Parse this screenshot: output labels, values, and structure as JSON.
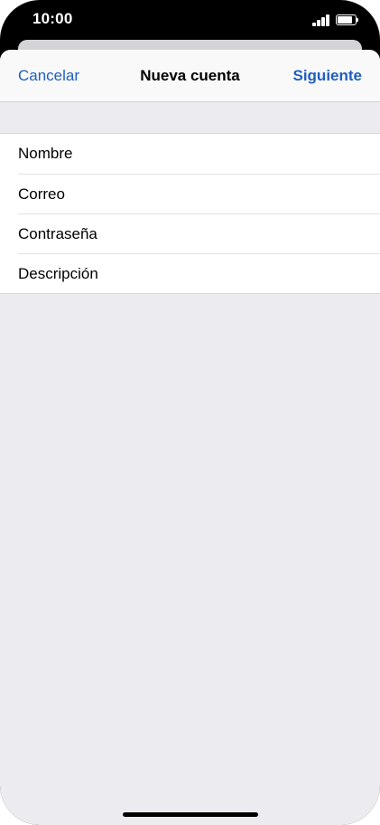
{
  "status_bar": {
    "time": "10:00",
    "signal_icon": "cellular-signal-icon",
    "battery_icon": "battery-icon",
    "battery_level": 0.9
  },
  "nav": {
    "cancel_label": "Cancelar",
    "title": "Nueva cuenta",
    "next_label": "Siguiente"
  },
  "form": {
    "fields": [
      {
        "placeholder": "Nombre",
        "value": ""
      },
      {
        "placeholder": "Correo",
        "value": ""
      },
      {
        "placeholder": "Contraseña",
        "value": ""
      },
      {
        "placeholder": "Descripción",
        "value": ""
      }
    ]
  },
  "colors": {
    "accent": "#1f5fbf",
    "background": "#ebebf0",
    "sheet_header": "#f9f9f9"
  }
}
